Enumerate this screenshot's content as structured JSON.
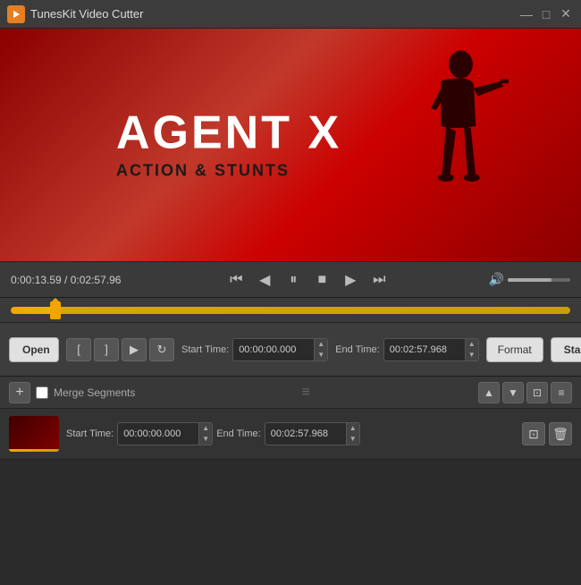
{
  "titleBar": {
    "title": "TunesKit Video Cutter",
    "icon": "🎬",
    "controls": {
      "minimize": "—",
      "maximize": "□",
      "close": "✕"
    }
  },
  "video": {
    "title": "AGENT X",
    "subtitle": "ACTION & STUNTS",
    "bg_color": "#c0392b"
  },
  "playback": {
    "current_time": "0:00:13.59",
    "total_time": "0:02:57.96",
    "time_display": "0:00:13.59 / 0:02:57.96",
    "controls": {
      "skip_back": "⏮",
      "step_back": "◀",
      "pause": "⏸",
      "stop": "■",
      "play": "▶",
      "skip_fwd": "⏭"
    }
  },
  "trimControls": {
    "open_label": "Open",
    "start_time_label": "Start Time:",
    "start_time_value": "00:00:00.000",
    "end_time_label": "End Time:",
    "end_time_value": "00:02:57.968",
    "format_label": "Format",
    "start_label": "Start",
    "trim_icons": {
      "mark_in": "[",
      "mark_out": "]",
      "play_seg": "▶",
      "loop": "↻"
    }
  },
  "segments": {
    "add_label": "+",
    "merge_label": "Merge Segments",
    "nav_up": "▲",
    "nav_down": "▼",
    "screen_btn": "⊡",
    "list_btn": "≡",
    "rows": [
      {
        "start_time": "00:00:00.000",
        "end_time": "00:02:57.968",
        "edit_icon": "⊡",
        "delete_icon": "🗑"
      }
    ]
  }
}
